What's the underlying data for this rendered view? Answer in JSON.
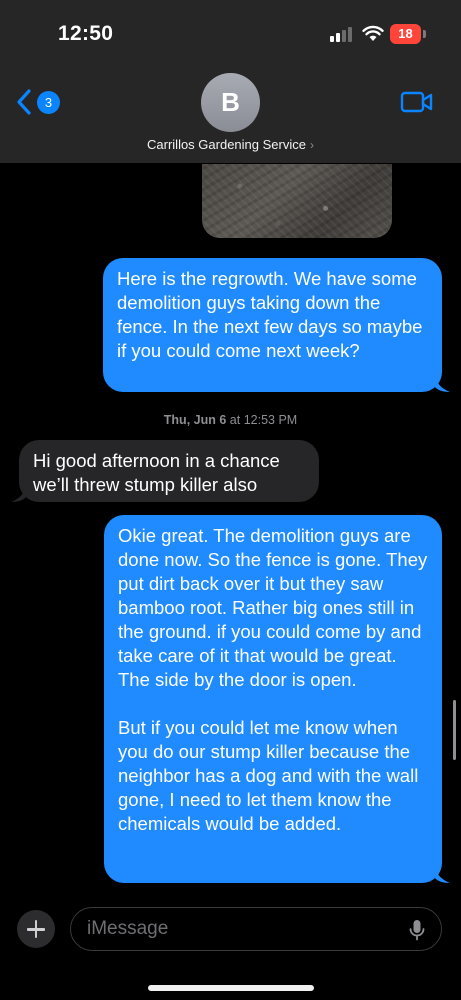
{
  "status_bar": {
    "time": "12:50",
    "battery_level": "18",
    "battery_color": "#ff453a"
  },
  "header": {
    "back_badge_count": "3",
    "avatar_initial": "B",
    "contact_name": "Carrillos Gardening Service",
    "contact_chevron": "›",
    "back_icon": "chevron-left-icon",
    "video_icon": "video-camera-icon"
  },
  "conversation": {
    "message_1": {
      "direction": "sent",
      "text": "Here is the regrowth. We have some demolition guys taking down the fence. In the next few days so maybe if you could come next week?"
    },
    "timestamp": {
      "day": "Thu, Jun 6",
      "at": "at",
      "time": "12:53 PM"
    },
    "message_2": {
      "direction": "received",
      "text": "Hi good afternoon in a chance we’ll threw stump killer also"
    },
    "message_3": {
      "direction": "sent",
      "paragraph_1": "Okie great. The demolition guys are done now. So the fence is gone. They put dirt back over it but they saw bamboo root. Rather big ones still in the ground. if you could come by and take care of it that would be great. The side by the door is open.",
      "paragraph_2": "But if you could let me know when you do our stump killer because the neighbor has a dog and with the wall gone, I need to let them know the chemicals would be added."
    }
  },
  "input_bar": {
    "placeholder": "iMessage",
    "plus_icon": "plus-icon",
    "mic_icon": "microphone-icon"
  },
  "colors": {
    "sent_bubble": "#1f8bff",
    "received_bubble": "#262628",
    "accent": "#0a84ff"
  }
}
